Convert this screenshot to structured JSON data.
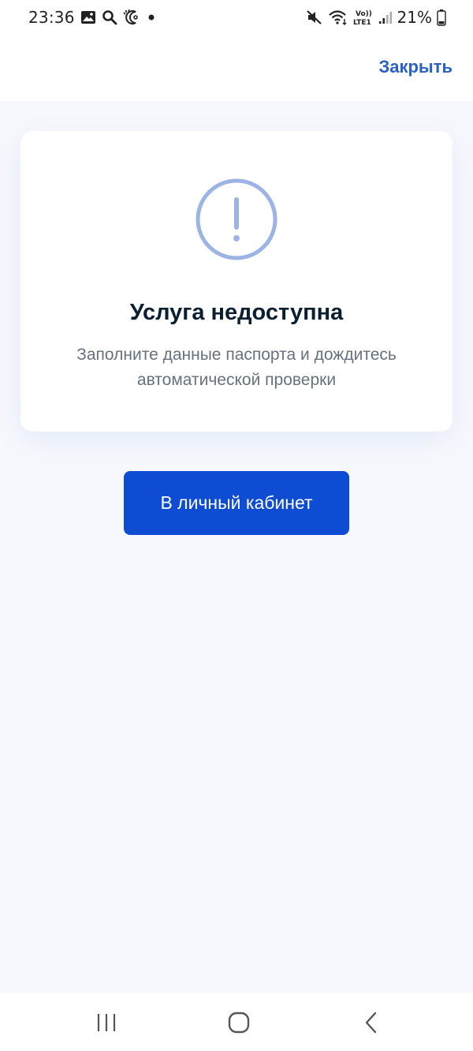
{
  "status_bar": {
    "time": "23:36",
    "battery": "21%",
    "left_icons": [
      "gallery-icon",
      "search-icon",
      "weather-icon",
      "dot-icon"
    ],
    "right_icons": [
      "mute-icon",
      "wifi-icon",
      "volte-lte-icon",
      "signal-icon",
      "battery-icon"
    ]
  },
  "header": {
    "close_label": "Закрыть"
  },
  "card": {
    "icon": "exclamation-circle-icon",
    "title": "Услуга недоступна",
    "text": "Заполните данные паспорта и дождитесь автоматической проверки"
  },
  "actions": {
    "cabinet_label": "В личный кабинет"
  },
  "nav_bar": {
    "items": [
      "recent-apps-icon",
      "home-icon",
      "back-icon"
    ]
  },
  "colors": {
    "accent": "#0d4cd3",
    "link": "#2a61c7",
    "icon": "#9cb3e6",
    "background": "#f6f8fd"
  }
}
